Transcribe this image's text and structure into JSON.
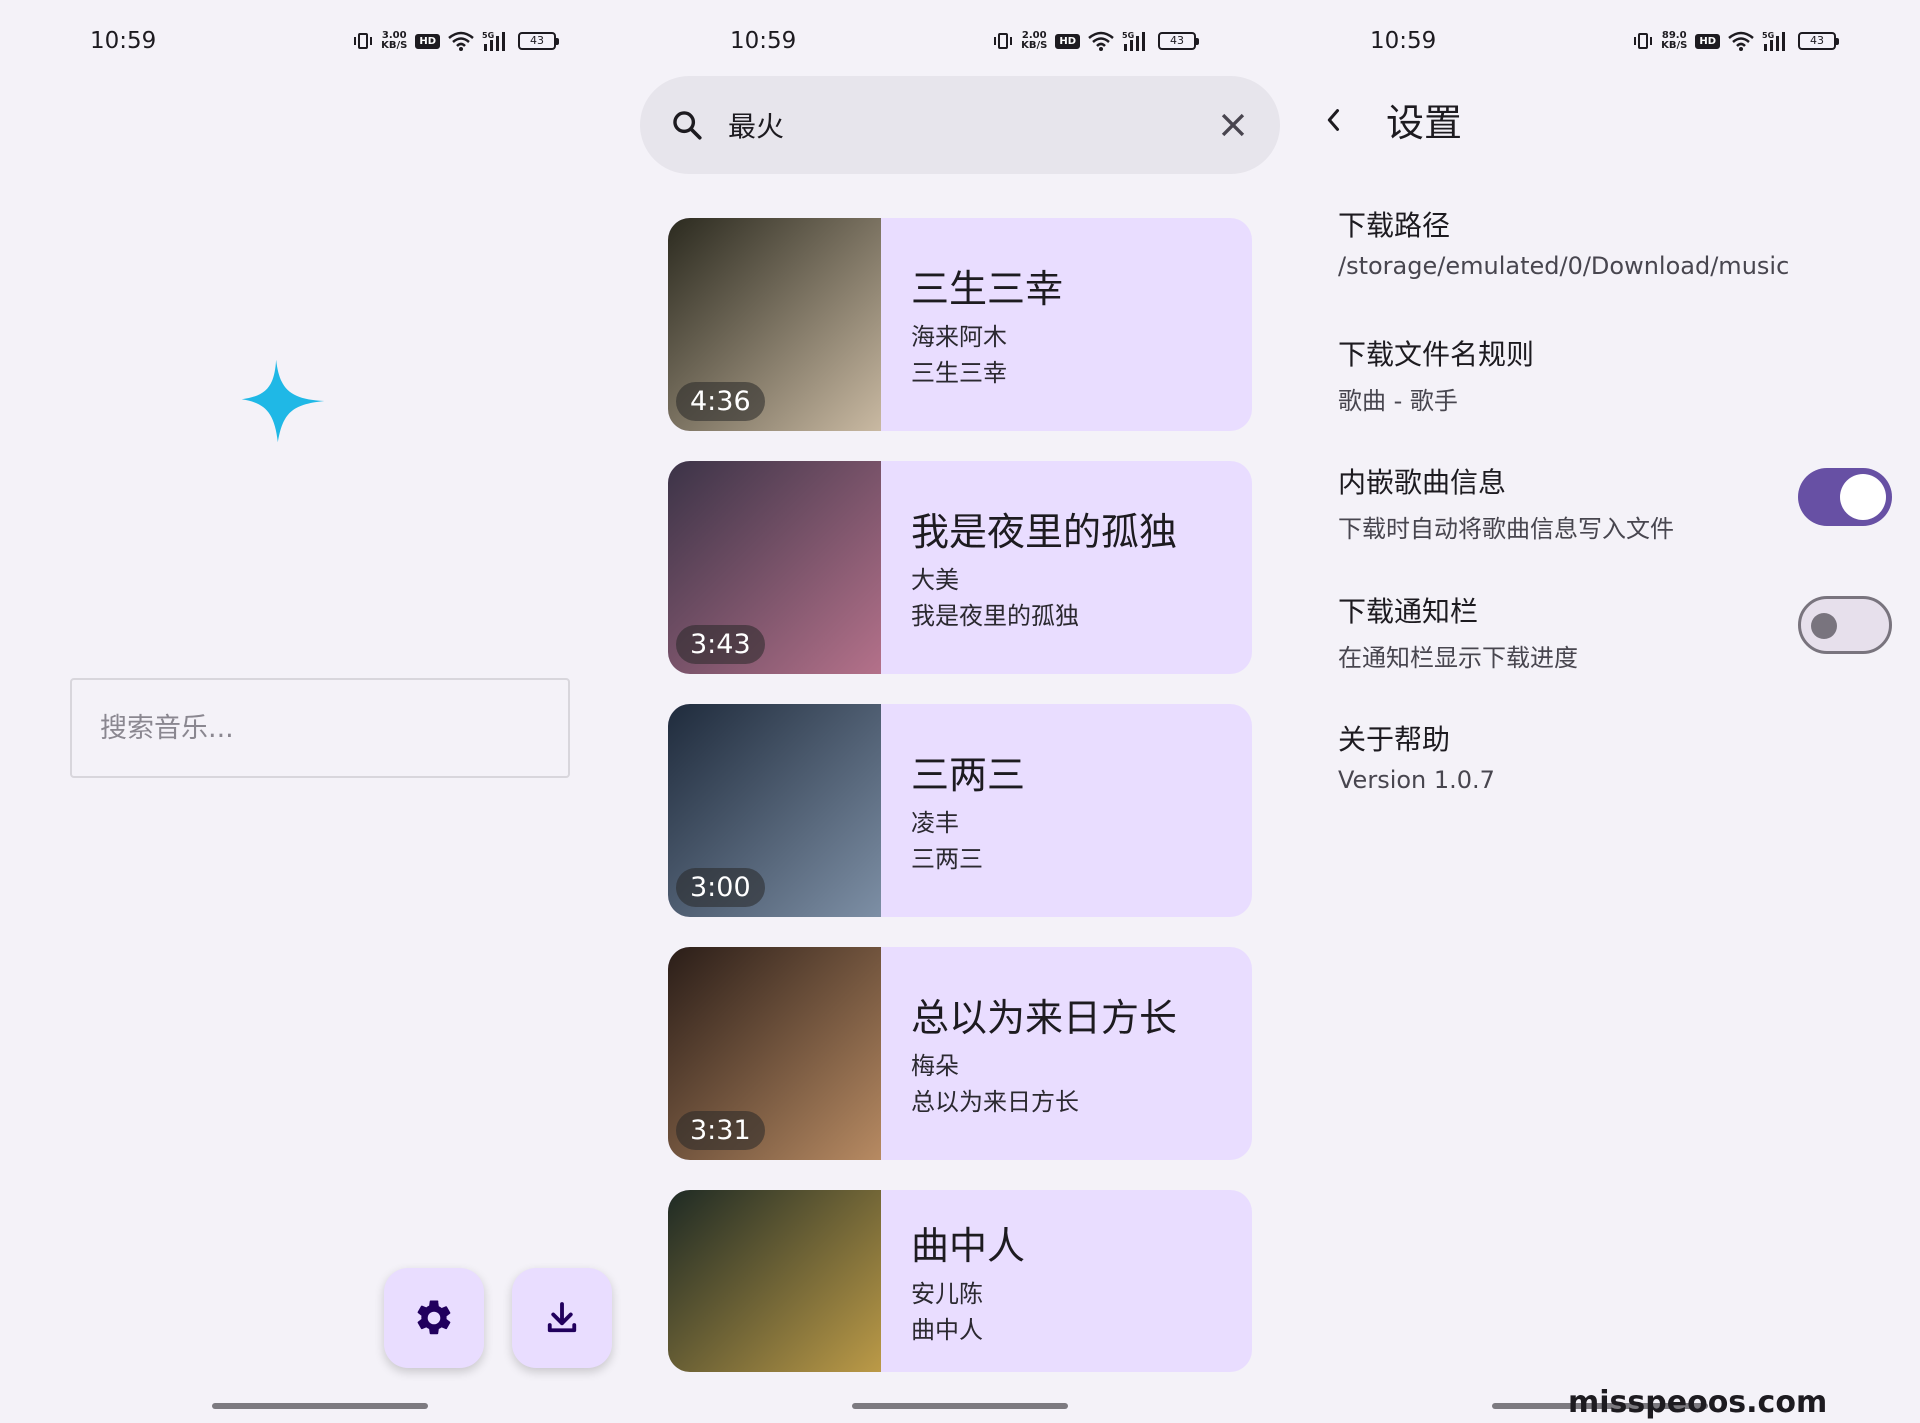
{
  "status": {
    "time": "10:59",
    "netspeed_left": [
      "3.00",
      "KB/S"
    ],
    "netspeed_mid": [
      "2.00",
      "KB/S"
    ],
    "netspeed_right": [
      "89.0",
      "KB/S"
    ],
    "hd": "HD",
    "signal": "5G",
    "battery": "43"
  },
  "home": {
    "search_placeholder": "搜索音乐...",
    "settings_icon": "gear-icon",
    "download_icon": "download-icon"
  },
  "results": {
    "query": "最火",
    "songs": [
      {
        "title": "三生三幸",
        "artist": "海来阿木",
        "album": "三生三幸",
        "duration": "4:36",
        "colors": [
          "#2b2a1f",
          "#c9b9a2"
        ]
      },
      {
        "title": "我是夜里的孤独",
        "artist": "大美",
        "album": "我是夜里的孤独",
        "duration": "3:43",
        "colors": [
          "#3b3347",
          "#b4718a"
        ]
      },
      {
        "title": "三两三",
        "artist": "凌丰",
        "album": "三两三",
        "duration": "3:00",
        "colors": [
          "#1f2b3c",
          "#7d8fa5"
        ]
      },
      {
        "title": "总以为来日方长",
        "artist": "梅朵",
        "album": "总以为来日方长",
        "duration": "3:31",
        "colors": [
          "#2a1d18",
          "#b78a62"
        ]
      },
      {
        "title": "曲中人",
        "artist": "安儿陈",
        "album": "曲中人",
        "duration": "",
        "colors": [
          "#1e2a24",
          "#c8a34a"
        ]
      }
    ]
  },
  "settings": {
    "title": "设置",
    "items": [
      {
        "label": "下载路径",
        "sub": "/storage/emulated/0/Download/music"
      },
      {
        "label": "下载文件名规则",
        "sub": "歌曲 - 歌手"
      },
      {
        "label": "内嵌歌曲信息",
        "sub": "下载时自动将歌曲信息写入文件",
        "toggle": true
      },
      {
        "label": "下载通知栏",
        "sub": "在通知栏显示下载进度",
        "toggle": false
      },
      {
        "label": "关于帮助",
        "sub": "Version 1.0.7"
      }
    ]
  },
  "watermark": "misspeoos.com",
  "colors": {
    "bg": "#f4f2f8",
    "card": "#e9ddff",
    "accent": "#6750a4",
    "sparkle": "#1fb8e6"
  }
}
